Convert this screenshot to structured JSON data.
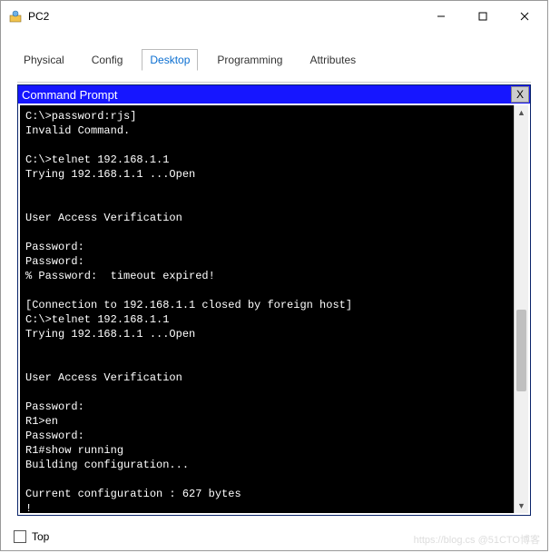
{
  "window": {
    "title": "PC2"
  },
  "tabs": {
    "physical": "Physical",
    "config": "Config",
    "desktop": "Desktop",
    "programming": "Programming",
    "attributes": "Attributes"
  },
  "cmd": {
    "title": "Command Prompt",
    "close": "X",
    "lines": [
      "C:\\>password:rjs]",
      "Invalid Command.",
      "",
      "C:\\>telnet 192.168.1.1",
      "Trying 192.168.1.1 ...Open",
      "",
      "",
      "User Access Verification",
      "",
      "Password: ",
      "Password: ",
      "% Password:  timeout expired!",
      "",
      "[Connection to 192.168.1.1 closed by foreign host]",
      "C:\\>telnet 192.168.1.1",
      "Trying 192.168.1.1 ...Open",
      "",
      "",
      "User Access Verification",
      "",
      "Password: ",
      "R1>en",
      "Password: ",
      "R1#show running",
      "Building configuration...",
      "",
      "Current configuration : 627 bytes",
      "!"
    ]
  },
  "footer": {
    "top_label": "Top"
  },
  "watermark": "https://blog.cs  @51CTO博客"
}
